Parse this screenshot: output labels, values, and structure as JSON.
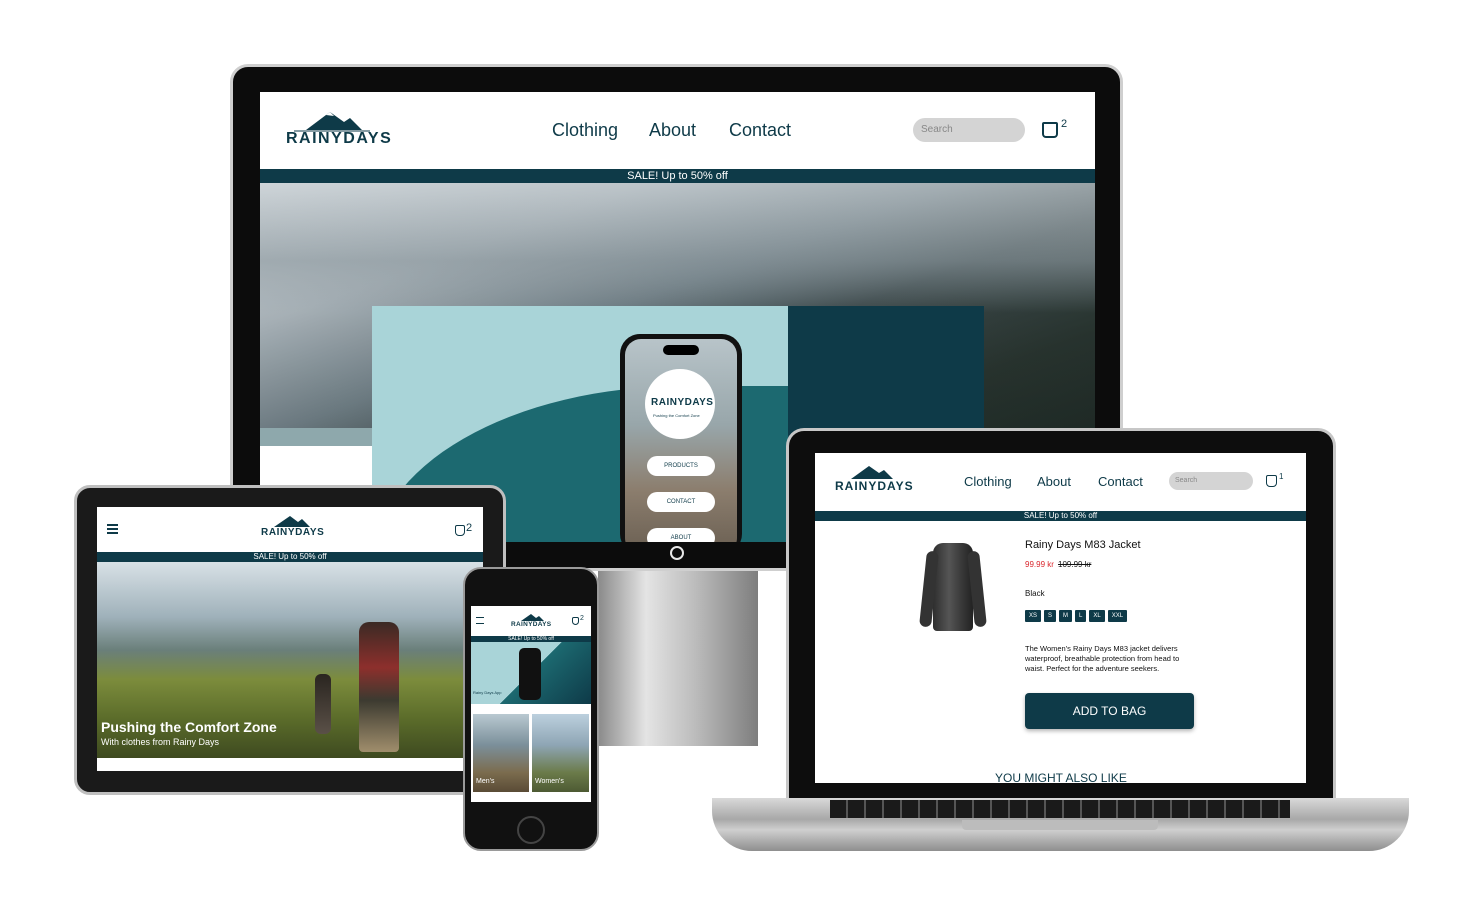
{
  "brand": {
    "name": "RAINYDAYS",
    "tagline": "Pushing the Comfort Zone"
  },
  "nav": {
    "items": [
      "Clothing",
      "About",
      "Contact"
    ]
  },
  "search": {
    "placeholder": "Search"
  },
  "cart": {
    "desktop_count": "2",
    "laptop_count": "1",
    "tablet_count": "2",
    "phone_count": "2"
  },
  "sale": {
    "text": "SALE! Up to 50% off"
  },
  "app_preview": {
    "buttons": [
      "PRODUCTS",
      "CONTACT",
      "ABOUT"
    ]
  },
  "tablet_hero": {
    "title": "Pushing the Comfort Zone",
    "subtitle": "With clothes from Rainy Days"
  },
  "phone_page": {
    "promo_title": "Rainy Days App",
    "tiles": [
      "Men's",
      "Women's"
    ]
  },
  "product": {
    "name": "Rainy Days M83 Jacket",
    "sale_price": "99.99 kr",
    "old_price": "109.99 kr",
    "color": "Black",
    "sizes": [
      "XS",
      "S",
      "M",
      "L",
      "XL",
      "XXL"
    ],
    "description": "The Women's Rainy Days M83 jacket delivers waterproof, breathable protection from head to waist. Perfect for the adventure seekers.",
    "add_to_bag": "ADD TO BAG",
    "related_heading": "YOU MIGHT ALSO LIKE"
  },
  "colors": {
    "brand": "#0e3a48",
    "sale_price": "#d9262c"
  }
}
